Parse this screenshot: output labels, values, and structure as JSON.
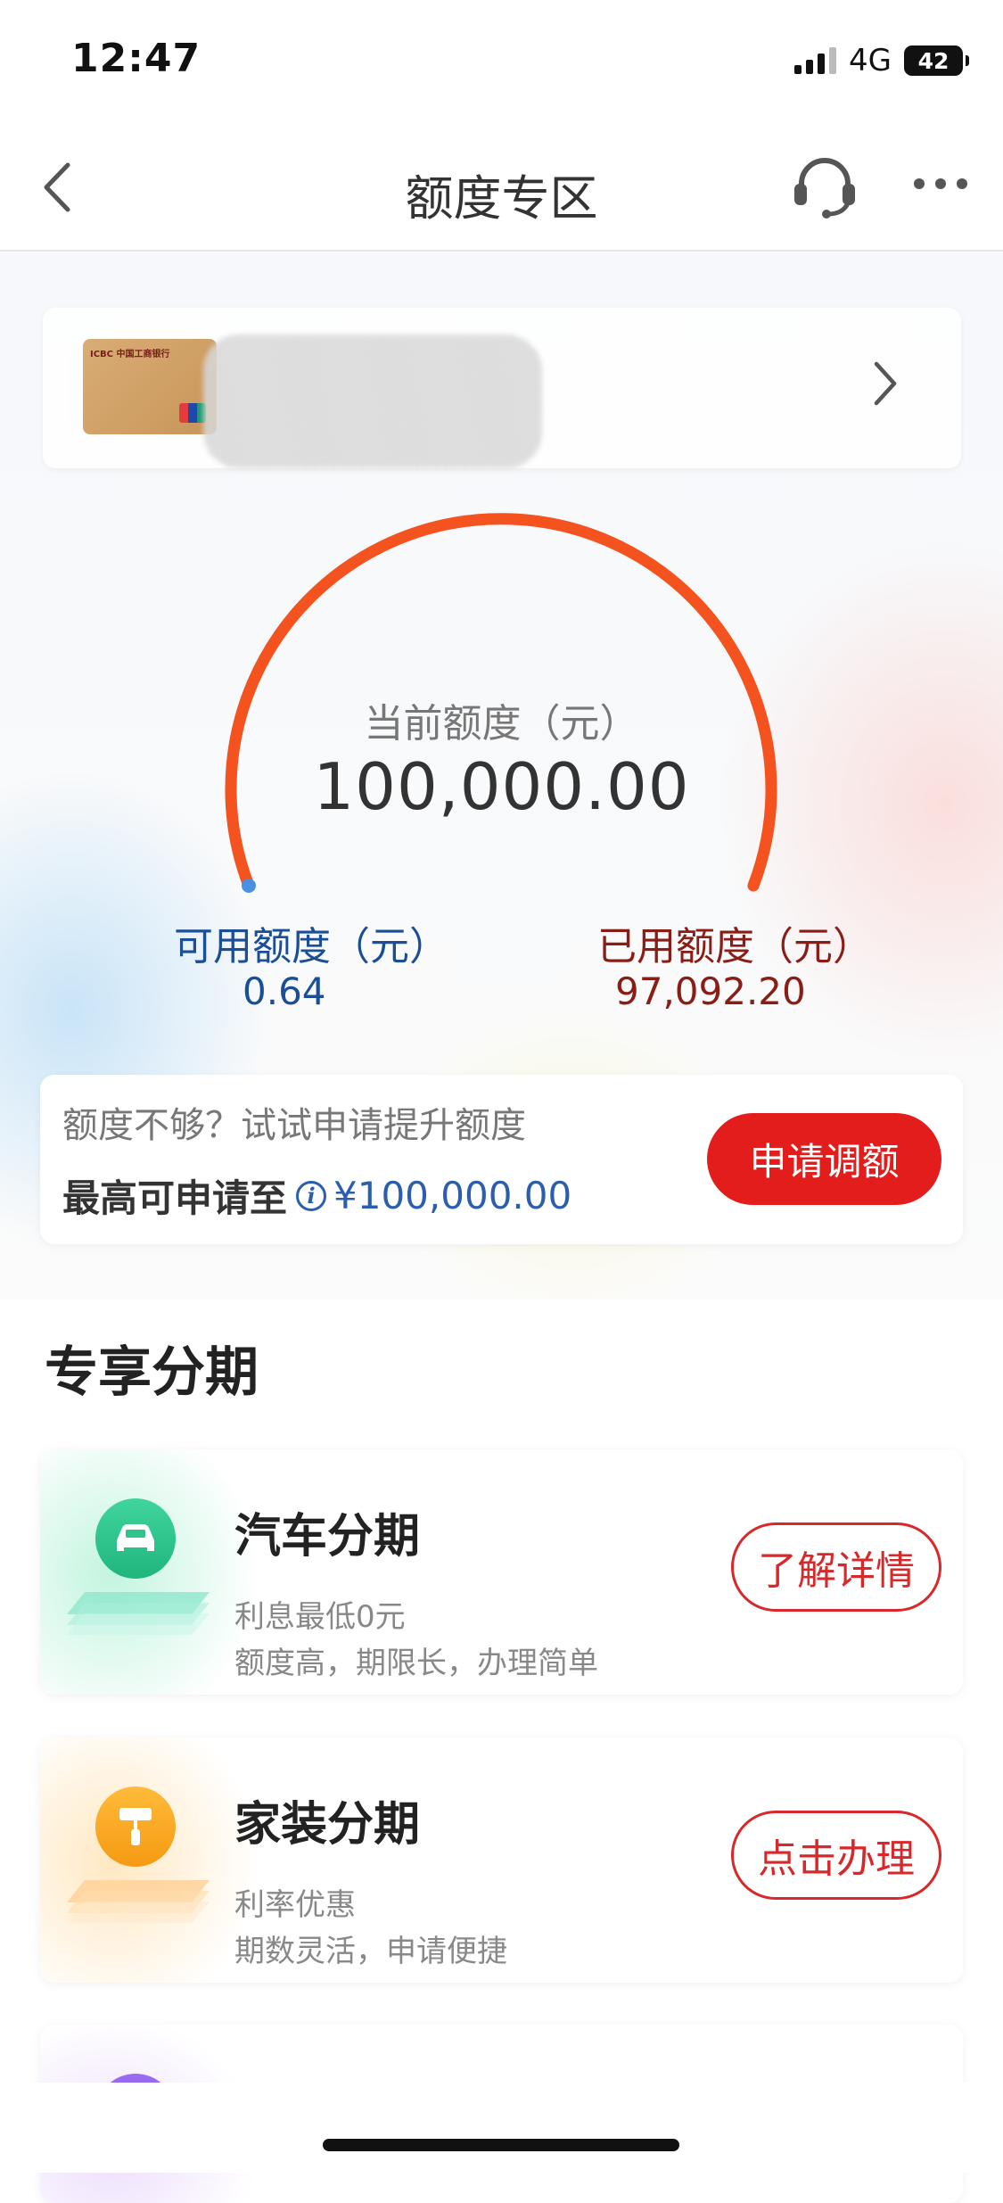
{
  "status_bar": {
    "time": "12:47",
    "network": "4G",
    "battery": "42"
  },
  "nav": {
    "title": "额度专区"
  },
  "gauge": {
    "label": "当前额度（元）",
    "total": "100,000.00",
    "available_label": "可用额度（元）",
    "available_value": "0.64",
    "used_label": "已用额度（元）",
    "used_value": "97,092.20",
    "arc_color": "#f4521e",
    "available_color": "#1a4f97",
    "used_color": "#8a1d15"
  },
  "raise": {
    "hint": "额度不够？试试申请提升额度",
    "max_label": "最高可申请至",
    "max_amount": "¥100,000.00",
    "button": "申请调额"
  },
  "section": {
    "title": "专享分期"
  },
  "promos": [
    {
      "title": "汽车分期",
      "sub1": "利息最低0元",
      "sub2": "额度高，期限长，办理简单",
      "button": "了解详情",
      "icon": "car-icon",
      "color": "#2ec48a"
    },
    {
      "title": "家装分期",
      "sub1": "利率优惠",
      "sub2": "期数灵活，申请便捷",
      "button": "点击办理",
      "icon": "paint-roller-icon",
      "color": "#f5a21c"
    }
  ]
}
